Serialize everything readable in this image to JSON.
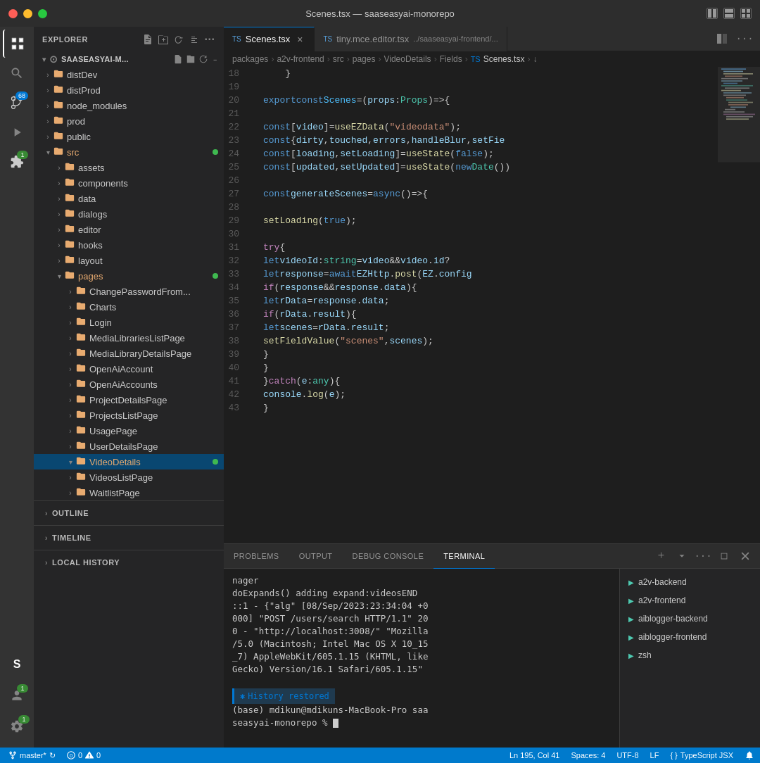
{
  "titleBar": {
    "title": "Scenes.tsx — saaseasyai-monorepo"
  },
  "activityBar": {
    "icons": [
      {
        "name": "explorer-icon",
        "symbol": "⧉",
        "active": true,
        "badge": null
      },
      {
        "name": "search-icon",
        "symbol": "🔍",
        "active": false,
        "badge": null
      },
      {
        "name": "source-control-icon",
        "symbol": "⑂",
        "active": false,
        "badge": "68"
      },
      {
        "name": "run-icon",
        "symbol": "▶",
        "active": false,
        "badge": null
      },
      {
        "name": "extensions-icon",
        "symbol": "⊞",
        "active": false,
        "badge": "1"
      },
      {
        "name": "accounts-icon",
        "symbol": "👤",
        "active": false,
        "badge": null
      }
    ],
    "bottomIcons": [
      {
        "name": "saas-icon",
        "symbol": "S",
        "active": false,
        "badge": null
      },
      {
        "name": "account-icon",
        "symbol": "👤",
        "active": false,
        "badge": "1"
      },
      {
        "name": "settings-icon",
        "symbol": "⚙",
        "active": false,
        "badge": "1"
      }
    ]
  },
  "sidebar": {
    "title": "EXPLORER",
    "rootName": "SAASEASYAI-M...",
    "tree": [
      {
        "level": 0,
        "type": "folder",
        "name": "distDev",
        "open": false,
        "dot": false
      },
      {
        "level": 0,
        "type": "folder",
        "name": "distProd",
        "open": false,
        "dot": false
      },
      {
        "level": 0,
        "type": "folder",
        "name": "node_modules",
        "open": false,
        "dot": false
      },
      {
        "level": 0,
        "type": "folder",
        "name": "prod",
        "open": false,
        "dot": false
      },
      {
        "level": 0,
        "type": "folder",
        "name": "public",
        "open": false,
        "dot": false
      },
      {
        "level": 0,
        "type": "folder",
        "name": "src",
        "open": true,
        "dot": true
      },
      {
        "level": 1,
        "type": "folder",
        "name": "assets",
        "open": false,
        "dot": false
      },
      {
        "level": 1,
        "type": "folder",
        "name": "components",
        "open": false,
        "dot": false
      },
      {
        "level": 1,
        "type": "folder",
        "name": "data",
        "open": false,
        "dot": false
      },
      {
        "level": 1,
        "type": "folder",
        "name": "dialogs",
        "open": false,
        "dot": false
      },
      {
        "level": 1,
        "type": "folder",
        "name": "editor",
        "open": false,
        "dot": false
      },
      {
        "level": 1,
        "type": "folder",
        "name": "hooks",
        "open": false,
        "dot": false
      },
      {
        "level": 1,
        "type": "folder",
        "name": "layout",
        "open": false,
        "dot": false
      },
      {
        "level": 1,
        "type": "folder",
        "name": "pages",
        "open": true,
        "dot": true
      },
      {
        "level": 2,
        "type": "folder",
        "name": "ChangePasswordFrom...",
        "open": false,
        "dot": false
      },
      {
        "level": 2,
        "type": "folder",
        "name": "Charts",
        "open": false,
        "dot": false
      },
      {
        "level": 2,
        "type": "folder",
        "name": "Login",
        "open": false,
        "dot": false
      },
      {
        "level": 2,
        "type": "folder",
        "name": "MediaLibrariesListPage",
        "open": false,
        "dot": false
      },
      {
        "level": 2,
        "type": "folder",
        "name": "MediaLibraryDetailsPage",
        "open": false,
        "dot": false
      },
      {
        "level": 2,
        "type": "folder",
        "name": "OpenAiAccount",
        "open": false,
        "dot": false
      },
      {
        "level": 2,
        "type": "folder",
        "name": "OpenAiAccounts",
        "open": false,
        "dot": false
      },
      {
        "level": 2,
        "type": "folder",
        "name": "ProjectDetailsPage",
        "open": false,
        "dot": false
      },
      {
        "level": 2,
        "type": "folder",
        "name": "ProjectsListPage",
        "open": false,
        "dot": false
      },
      {
        "level": 2,
        "type": "folder",
        "name": "UsagePage",
        "open": false,
        "dot": false
      },
      {
        "level": 2,
        "type": "folder",
        "name": "UserDetailsPage",
        "open": false,
        "dot": false
      },
      {
        "level": 2,
        "type": "folder",
        "name": "VideoDetails",
        "open": true,
        "dot": true,
        "selected": true
      },
      {
        "level": 2,
        "type": "folder",
        "name": "VideosListPage",
        "open": false,
        "dot": false
      },
      {
        "level": 2,
        "type": "folder",
        "name": "WaitlistPage",
        "open": false,
        "dot": false
      }
    ],
    "sections": [
      {
        "name": "OUTLINE"
      },
      {
        "name": "TIMELINE"
      },
      {
        "name": "LOCAL HISTORY"
      }
    ]
  },
  "tabs": [
    {
      "lang": "TS",
      "name": "Scenes.tsx",
      "active": true,
      "closeable": true
    },
    {
      "lang": "TS",
      "name": "tiny.mce.editor.tsx",
      "path": "../saaseasyai-frontend/...",
      "active": false,
      "closeable": false
    }
  ],
  "breadcrumb": [
    "packages",
    "a2v-frontend",
    "src",
    "pages",
    "VideoDetails",
    "Fields",
    "TS Scenes.tsx",
    "↓"
  ],
  "codeEditor": {
    "startLine": 18,
    "lines": [
      {
        "num": 18,
        "content": "    }"
      },
      {
        "num": 19,
        "content": ""
      },
      {
        "num": 20,
        "content": "export const Scenes = (props: Props) => {"
      },
      {
        "num": 21,
        "content": ""
      },
      {
        "num": 22,
        "content": "    const [video] = useEZData(\"videodata\");"
      },
      {
        "num": 23,
        "content": "    const { dirty, touched, errors, handleBlur, setFie"
      },
      {
        "num": 24,
        "content": "    const [loading, setLoading] = useState(false);"
      },
      {
        "num": 25,
        "content": "    const [updated, setUpdated] = useState(new Date())"
      },
      {
        "num": 26,
        "content": ""
      },
      {
        "num": 27,
        "content": "    const generateScenes = async () => {"
      },
      {
        "num": 28,
        "content": ""
      },
      {
        "num": 29,
        "content": "        setLoading(true);"
      },
      {
        "num": 30,
        "content": ""
      },
      {
        "num": 31,
        "content": "        try{"
      },
      {
        "num": 32,
        "content": "            let videoId: string = video && video.id ?"
      },
      {
        "num": 33,
        "content": "            let response = await EZHttp.post(EZ.config"
      },
      {
        "num": 34,
        "content": "            if(response && response.data){"
      },
      {
        "num": 35,
        "content": "                let rData = response.data;"
      },
      {
        "num": 36,
        "content": "                if(rData.result){"
      },
      {
        "num": 37,
        "content": "                    let scenes = rData.result;"
      },
      {
        "num": 38,
        "content": "                    setFieldValue(\"scenes\", scenes);"
      },
      {
        "num": 39,
        "content": "                }"
      },
      {
        "num": 40,
        "content": "            }"
      },
      {
        "num": 41,
        "content": "        }catch(e: any){"
      },
      {
        "num": 42,
        "content": "            console.log(e);"
      },
      {
        "num": 43,
        "content": "        }"
      }
    ]
  },
  "terminal": {
    "tabs": [
      "PROBLEMS",
      "OUTPUT",
      "DEBUG CONSOLE",
      "TERMINAL"
    ],
    "activeTab": "TERMINAL",
    "content": [
      "nager",
      "doExpands() adding expand:videosEND",
      "::1 - {\"alg\" [08/Sep/2023:23:34:04 +0",
      "000] \"POST /users/search HTTP/1.1\" 20",
      "0 - \"http://localhost:3008/\" \"Mozilla",
      "/5.0 (Macintosh; Intel Mac OS X 10_15",
      "_7) AppleWebKit/605.1.15 (KHTML, like",
      "Gecko) Version/16.1 Safari/605.1.15\""
    ],
    "historyRestored": "History restored",
    "prompt": "(base) mdikun@mdikuns-MacBook-Pro saa",
    "promptCont": "seasyai-monorepo %",
    "shells": [
      {
        "name": "a2v-backend"
      },
      {
        "name": "a2v-frontend"
      },
      {
        "name": "aiblogger-backend"
      },
      {
        "name": "aiblogger-frontend"
      },
      {
        "name": "zsh"
      }
    ]
  },
  "statusBar": {
    "branch": "master*",
    "sync": "↻",
    "errors": "⓪ 0",
    "warnings": "△ 0",
    "position": "Ln 195, Col 41",
    "spaces": "Spaces: 4",
    "encoding": "UTF-8",
    "lineEnding": "LF",
    "language": "TypeScript JSX",
    "bell": "🔔"
  }
}
